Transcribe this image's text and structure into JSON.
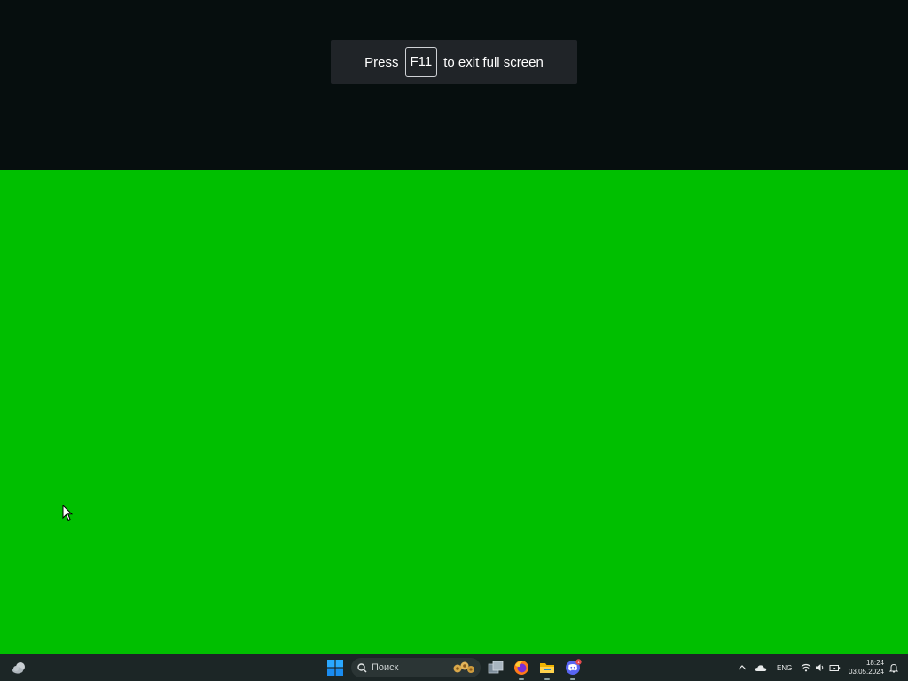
{
  "fullscreen_notice": {
    "prefix": "Press",
    "key": "F11",
    "suffix": "to exit full screen"
  },
  "taskbar": {
    "search_placeholder": "Поиск",
    "apps": [
      {
        "icon": "task-view-icon"
      },
      {
        "icon": "firefox-icon"
      },
      {
        "icon": "file-explorer-icon"
      },
      {
        "icon": "discord-icon",
        "badge": "1"
      }
    ],
    "tray": {
      "language": "ENG",
      "time": "18:24",
      "date": "03.05.2024"
    }
  },
  "colors": {
    "page_background": "#00bf00",
    "top_background": "#060e0e",
    "taskbar": "#1c2626",
    "start_blue": "#1e90ff"
  }
}
